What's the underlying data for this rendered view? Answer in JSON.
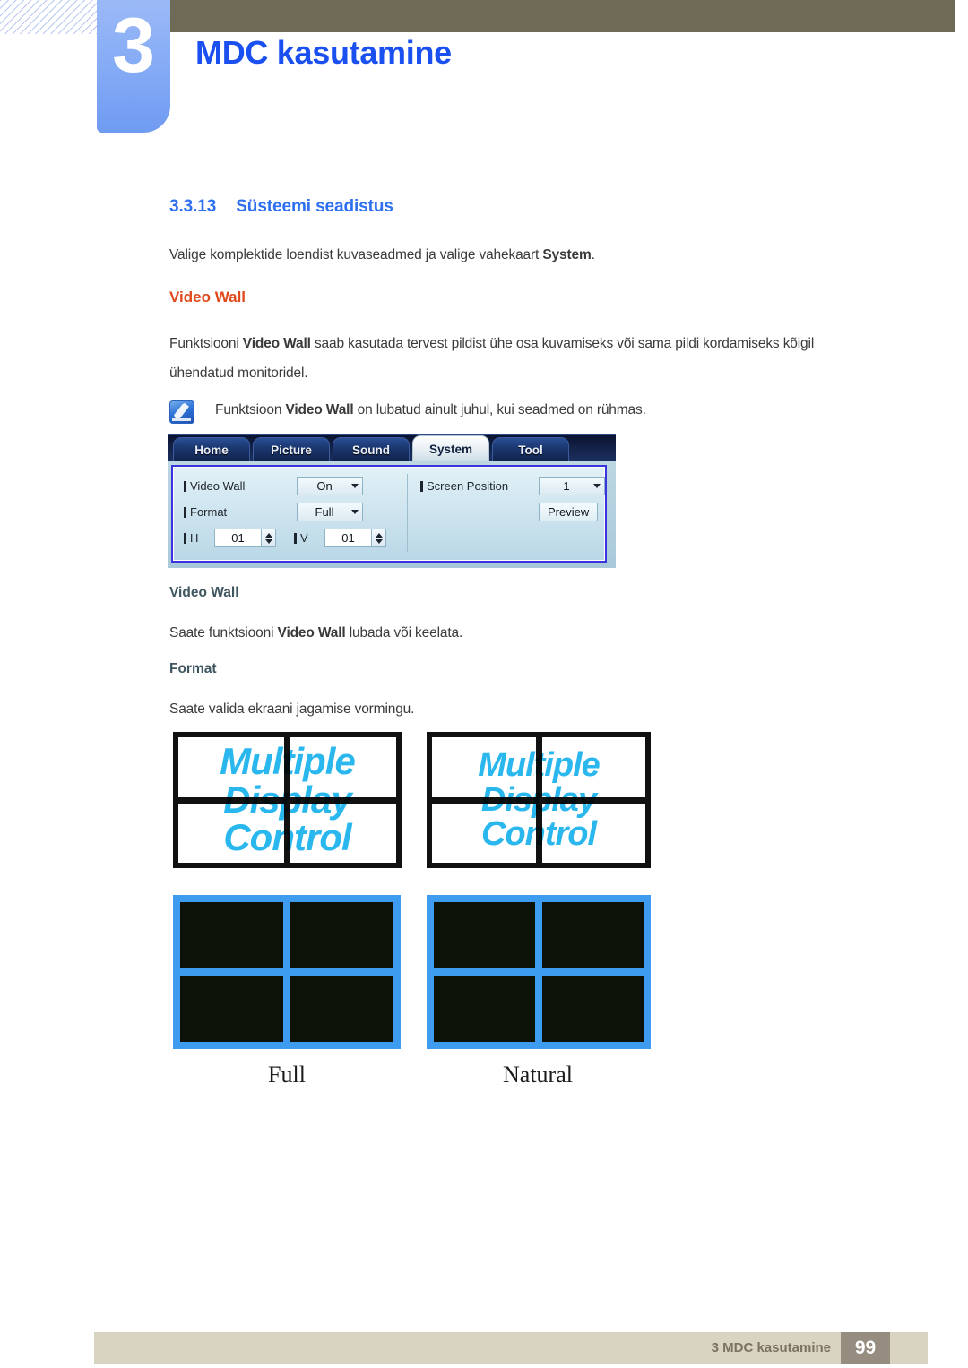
{
  "header": {
    "chapter_number": "3",
    "chapter_title": "MDC kasutamine"
  },
  "section": {
    "number": "3.3.13",
    "title": "Süsteemi seadistus",
    "intro_pre": "Valige komplektide loendist kuvaseadmed ja valige vahekaart ",
    "intro_bold": "System",
    "intro_post": "."
  },
  "video_wall_section": {
    "heading": "Video Wall",
    "para_pre": "Funktsiooni ",
    "para_bold": "Video Wall",
    "para_post": " saab kasutada tervest pildist ühe osa kuvamiseks või sama pildi kordamiseks kõigil ühendatud monitoridel.",
    "note_pre": "Funktsioon ",
    "note_bold": "Video Wall",
    "note_post": " on lubatud ainult juhul, kui seadmed on rühmas."
  },
  "mdc_dialog": {
    "tabs": [
      {
        "label": "Home",
        "active": false
      },
      {
        "label": "Picture",
        "active": false
      },
      {
        "label": "Sound",
        "active": false
      },
      {
        "label": "System",
        "active": true
      },
      {
        "label": "Tool",
        "active": false
      }
    ],
    "fields": {
      "video_wall_label": "Video Wall",
      "video_wall_value": "On",
      "format_label": "Format",
      "format_value": "Full",
      "h_label": "H",
      "h_value": "01",
      "v_label": "V",
      "v_value": "01",
      "screen_position_label": "Screen Position",
      "screen_position_value": "1",
      "preview_button": "Preview"
    }
  },
  "subsections": [
    {
      "heading": "Video Wall",
      "para_pre": "Saate funktsiooni ",
      "para_bold": "Video Wall",
      "para_post": " lubada või keelata."
    },
    {
      "heading": "Format",
      "para_pre": "Saate valida ekraani jagamise vormingu.",
      "para_bold": "",
      "para_post": ""
    }
  ],
  "figures": {
    "wall_text_lines": [
      "Multiple",
      "Display",
      "Control"
    ],
    "captions": [
      "Full",
      "Natural"
    ],
    "bezel_color_text_wall": "#111111",
    "bezel_color_photo_wall": "#3d9cf0",
    "wall_text_color": "#29b7ee"
  },
  "footer": {
    "label": "3 MDC kasutamine",
    "page_number": "99"
  }
}
